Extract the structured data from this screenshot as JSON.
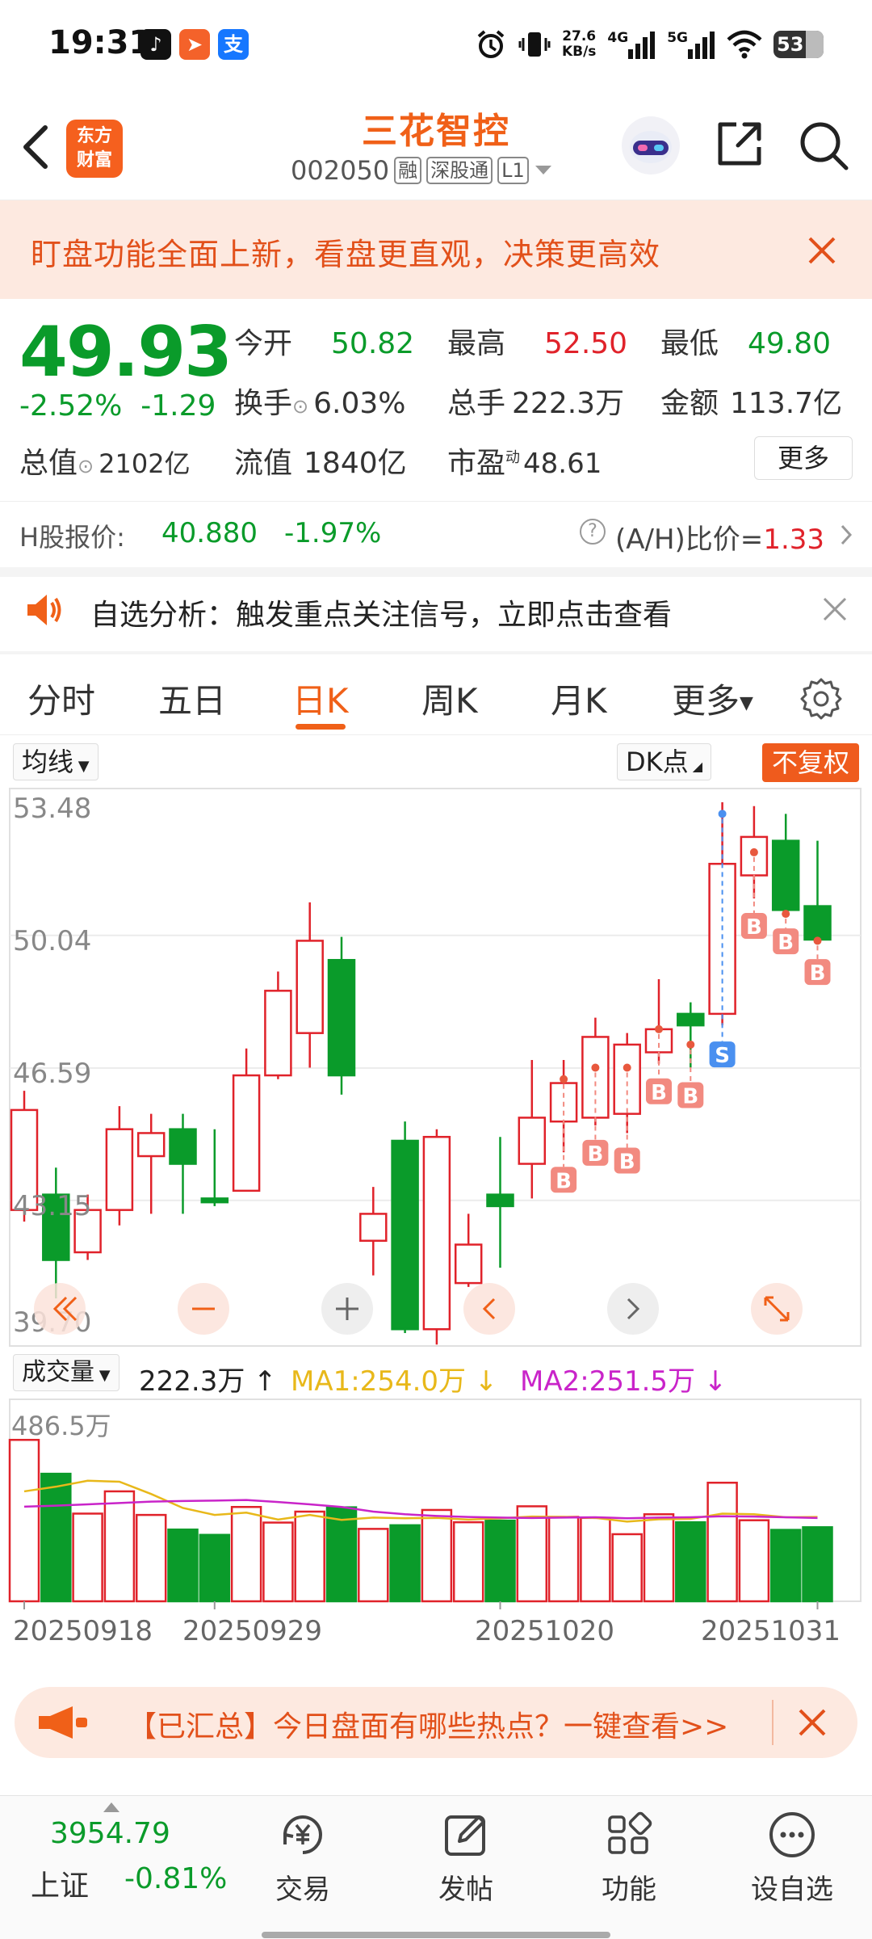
{
  "status_bar": {
    "time": "19:31",
    "net_speed": "27.6",
    "net_speed_unit": "KB/s",
    "net1": "4G",
    "net2": "5G",
    "battery": "53",
    "icons": [
      "tiktok-icon",
      "feishu-icon",
      "alipay-icon",
      "alarm-icon",
      "vibrate-icon",
      "signal-icon",
      "wifi-icon",
      "battery-icon"
    ]
  },
  "header": {
    "logo_line1": "东方",
    "logo_line2": "财富",
    "stock_name": "三花智控",
    "stock_code": "002050",
    "tag1": "融",
    "tag2": "深股通",
    "tag3": "L1"
  },
  "banner": {
    "text": "盯盘功能全面上新，看盘更直观，决策更高效"
  },
  "quote": {
    "price": "49.93",
    "change_pct": "-2.52%",
    "change": "-1.29",
    "open_label": "今开",
    "open": "50.82",
    "high_label": "最高",
    "high": "52.50",
    "low_label": "最低",
    "low": "49.80",
    "turnover_label": "换手",
    "turnover": "6.03%",
    "volume_label": "总手",
    "volume": "222.3万",
    "amount_label": "金额",
    "amount": "113.7亿",
    "mktcap_label": "总值",
    "mktcap": "2102亿",
    "float_label": "流值",
    "float": "1840亿",
    "pe_label": "市盈",
    "pe_sup": "动",
    "pe": "48.61",
    "more": "更多"
  },
  "hshare": {
    "label": "H股报价:",
    "price": "40.880",
    "pct": "-1.97%",
    "ratio_label": "(A/H)比价=",
    "ratio": "1.33"
  },
  "notice": {
    "text": "自选分析：触发重点关注信号，立即点击查看"
  },
  "tabs": [
    "分时",
    "五日",
    "日K",
    "周K",
    "月K",
    "更多"
  ],
  "active_tab": "日K",
  "chart_tools": {
    "ma": "均线",
    "dk": "DK点",
    "adjust": "不复权"
  },
  "chart_data": {
    "type": "candlestick",
    "y_labels": [
      "53.48",
      "50.04",
      "46.59",
      "43.15",
      "39.70"
    ],
    "ylim": [
      39.7,
      53.48
    ],
    "dates": [
      "20250918",
      "20250929",
      "20251020",
      "20251031"
    ],
    "candles": [
      {
        "o": 42.9,
        "c": 45.5,
        "h": 46.0,
        "l": 42.6
      },
      {
        "o": 43.3,
        "c": 41.6,
        "h": 44.0,
        "l": 40.6
      },
      {
        "o": 41.8,
        "c": 42.9,
        "h": 43.3,
        "l": 41.6
      },
      {
        "o": 42.9,
        "c": 45.0,
        "h": 45.6,
        "l": 42.5
      },
      {
        "o": 44.3,
        "c": 44.9,
        "h": 45.4,
        "l": 42.8
      },
      {
        "o": 45.0,
        "c": 44.1,
        "h": 45.4,
        "l": 42.8
      },
      {
        "o": 43.2,
        "c": 43.1,
        "h": 45.0,
        "l": 43.0
      },
      {
        "o": 43.4,
        "c": 46.4,
        "h": 47.1,
        "l": 43.4
      },
      {
        "o": 46.4,
        "c": 48.6,
        "h": 49.1,
        "l": 46.3
      },
      {
        "o": 47.5,
        "c": 49.9,
        "h": 50.9,
        "l": 46.6
      },
      {
        "o": 49.4,
        "c": 46.4,
        "h": 50.0,
        "l": 45.9
      },
      {
        "o": 42.1,
        "c": 42.8,
        "h": 43.5,
        "l": 41.2
      },
      {
        "o": 44.7,
        "c": 39.8,
        "h": 45.2,
        "l": 39.7
      },
      {
        "o": 39.8,
        "c": 44.8,
        "h": 45.0,
        "l": 39.4
      },
      {
        "o": 41.0,
        "c": 42.0,
        "h": 42.8,
        "l": 40.9
      },
      {
        "o": 43.3,
        "c": 43.0,
        "h": 44.8,
        "l": 41.4
      },
      {
        "o": 44.1,
        "c": 45.3,
        "h": 46.8,
        "l": 43.2
      },
      {
        "o": 45.2,
        "c": 46.2,
        "h": 46.8,
        "l": 44.4
      },
      {
        "o": 45.3,
        "c": 47.4,
        "h": 47.9,
        "l": 45.1
      },
      {
        "o": 45.4,
        "c": 47.2,
        "h": 47.5,
        "l": 44.9
      },
      {
        "o": 47.0,
        "c": 47.6,
        "h": 48.9,
        "l": 46.7
      },
      {
        "o": 48.0,
        "c": 47.7,
        "h": 48.3,
        "l": 46.6
      },
      {
        "o": 48.0,
        "c": 51.9,
        "h": 53.5,
        "l": 47.7
      },
      {
        "o": 51.6,
        "c": 52.6,
        "h": 53.4,
        "l": 51.0
      },
      {
        "o": 52.5,
        "c": 50.7,
        "h": 53.2,
        "l": 50.6
      },
      {
        "o": 50.8,
        "c": 49.93,
        "h": 52.5,
        "l": 49.8
      }
    ],
    "signals": [
      {
        "i": 17,
        "label": "B",
        "price": 46.3
      },
      {
        "i": 18,
        "label": "B",
        "price": 46.6
      },
      {
        "i": 19,
        "label": "B",
        "price": 46.6
      },
      {
        "i": 20,
        "label": "B",
        "price": 47.6
      },
      {
        "i": 21,
        "label": "B",
        "price": 47.2
      },
      {
        "i": 22,
        "label": "S",
        "price": 53.2
      },
      {
        "i": 23,
        "label": "B",
        "price": 52.2
      },
      {
        "i": 24,
        "label": "B",
        "price": 50.6
      },
      {
        "i": 25,
        "label": "B",
        "price": 49.9
      }
    ],
    "colors": {
      "up": "#e0222a",
      "down": "#0a9b2a",
      "buy": "#f28a80",
      "sell": "#4a90f0"
    }
  },
  "volume": {
    "selector": "成交量",
    "value": "222.3万",
    "ma1": "MA1:254.0万",
    "ma2": "MA2:251.5万",
    "max_label": "486.5万",
    "max": 486.5,
    "bars": [
      486,
      384,
      264,
      331,
      260,
      216,
      200,
      284,
      237,
      270,
      283,
      218,
      229,
      275,
      238,
      243,
      286,
      254,
      251,
      202,
      262,
      238,
      357,
      244,
      215,
      223
    ],
    "ma1_line": [
      331,
      345,
      363,
      360,
      323,
      281,
      260,
      267,
      246,
      260,
      245,
      252,
      250,
      251,
      246,
      250,
      255,
      254,
      251,
      240,
      247,
      248,
      264,
      262,
      253,
      254
    ],
    "ma2_line": [
      285,
      288,
      292,
      296,
      300,
      302,
      303,
      305,
      299,
      292,
      284,
      270,
      262,
      257,
      254,
      252,
      251,
      252,
      253,
      250,
      252,
      253,
      256,
      255,
      253,
      251
    ]
  },
  "promo": {
    "text": "【已汇总】今日盘面有哪些热点？一键查看>>"
  },
  "bottom": {
    "index_value": "3954.79",
    "index_name": "上证",
    "index_change": "-0.81%",
    "nav": [
      "交易",
      "发帖",
      "功能",
      "设自选"
    ]
  }
}
